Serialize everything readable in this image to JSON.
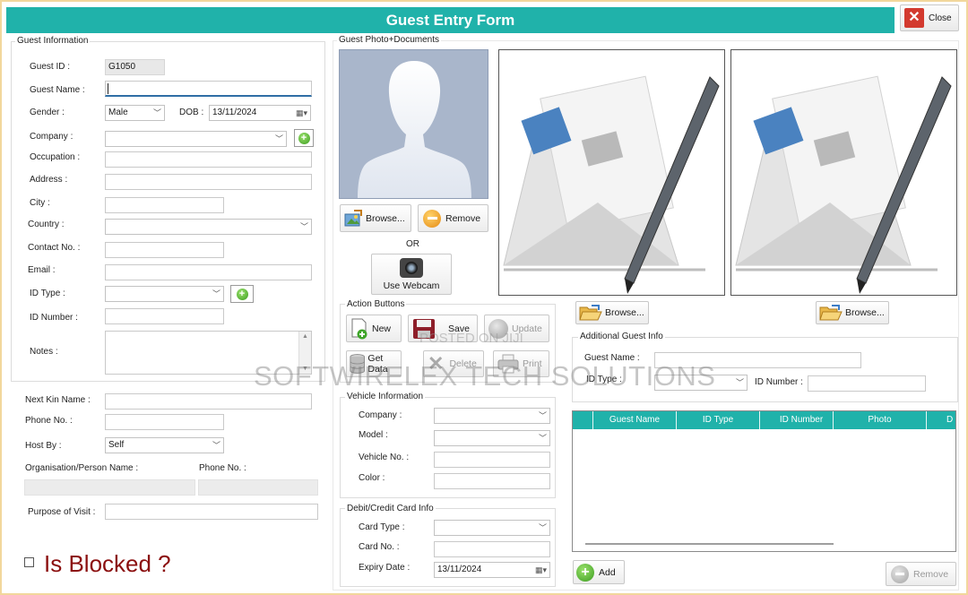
{
  "window": {
    "title": "Guest Entry Form",
    "close_label": "Close"
  },
  "guest_info": {
    "group_title": "Guest Information",
    "guest_id_label": "Guest ID :",
    "guest_id_value": "G1050",
    "guest_name_label": "Guest Name :",
    "guest_name_value": "",
    "gender_label": "Gender :",
    "gender_value": "Male",
    "dob_label": "DOB :",
    "dob_value": "13/11/2024",
    "company_label": "Company :",
    "occupation_label": "Occupation :",
    "address_label": "Address :",
    "city_label": "City :",
    "country_label": "Country :",
    "contact_label": "Contact No. :",
    "email_label": "Email :",
    "id_type_label": "ID Type :",
    "id_number_label": "ID Number :",
    "notes_label": "Notes :"
  },
  "kin": {
    "next_kin_label": "Next Kin Name :",
    "phone_label": "Phone No. :",
    "host_by_label": "Host By :",
    "host_by_value": "Self",
    "org_label": "Organisation/Person Name :",
    "org_phone_label": "Phone No. :",
    "purpose_label": "Purpose of Visit :"
  },
  "blocked": {
    "label": "Is Blocked ?"
  },
  "photo": {
    "group_title": "Guest Photo+Documents",
    "browse_label": "Browse...",
    "remove_label": "Remove",
    "or_label": "OR",
    "webcam_label": "Use Webcam",
    "doc_browse_1": "Browse...",
    "doc_browse_2": "Browse..."
  },
  "actions": {
    "group_title": "Action Buttons",
    "new_label": "New",
    "save_label": "Save",
    "update_label": "Update",
    "get_data_label": "Get Data",
    "delete_label": "Delete",
    "print_label": "Print"
  },
  "vehicle": {
    "group_title": "Vehicle Information",
    "company_label": "Company :",
    "model_label": "Model :",
    "vehicle_no_label": "Vehicle No. :",
    "color_label": "Color :"
  },
  "card": {
    "group_title": "Debit/Credit Card Info",
    "card_type_label": "Card Type :",
    "card_no_label": "Card No. :",
    "expiry_label": "Expiry Date :",
    "expiry_value": "13/11/2024"
  },
  "additional": {
    "group_title": "Additional Guest Info",
    "guest_name_label": "Guest Name :",
    "id_type_label": "ID Type :",
    "id_number_label": "ID Number :",
    "columns": [
      "Guest Name",
      "ID Type",
      "ID Number",
      "Photo",
      "D"
    ],
    "add_label": "Add",
    "remove_label": "Remove"
  },
  "overlay": {
    "watermark": "SOFTWIRELEX TECH SOLUTIONS",
    "posted": "POSTED ON JIJI"
  },
  "colors": {
    "accent": "#20b2aa",
    "close_red": "#d33a2f",
    "blocked_red": "#8b0f0f",
    "border_gold": "#f2d79c"
  }
}
